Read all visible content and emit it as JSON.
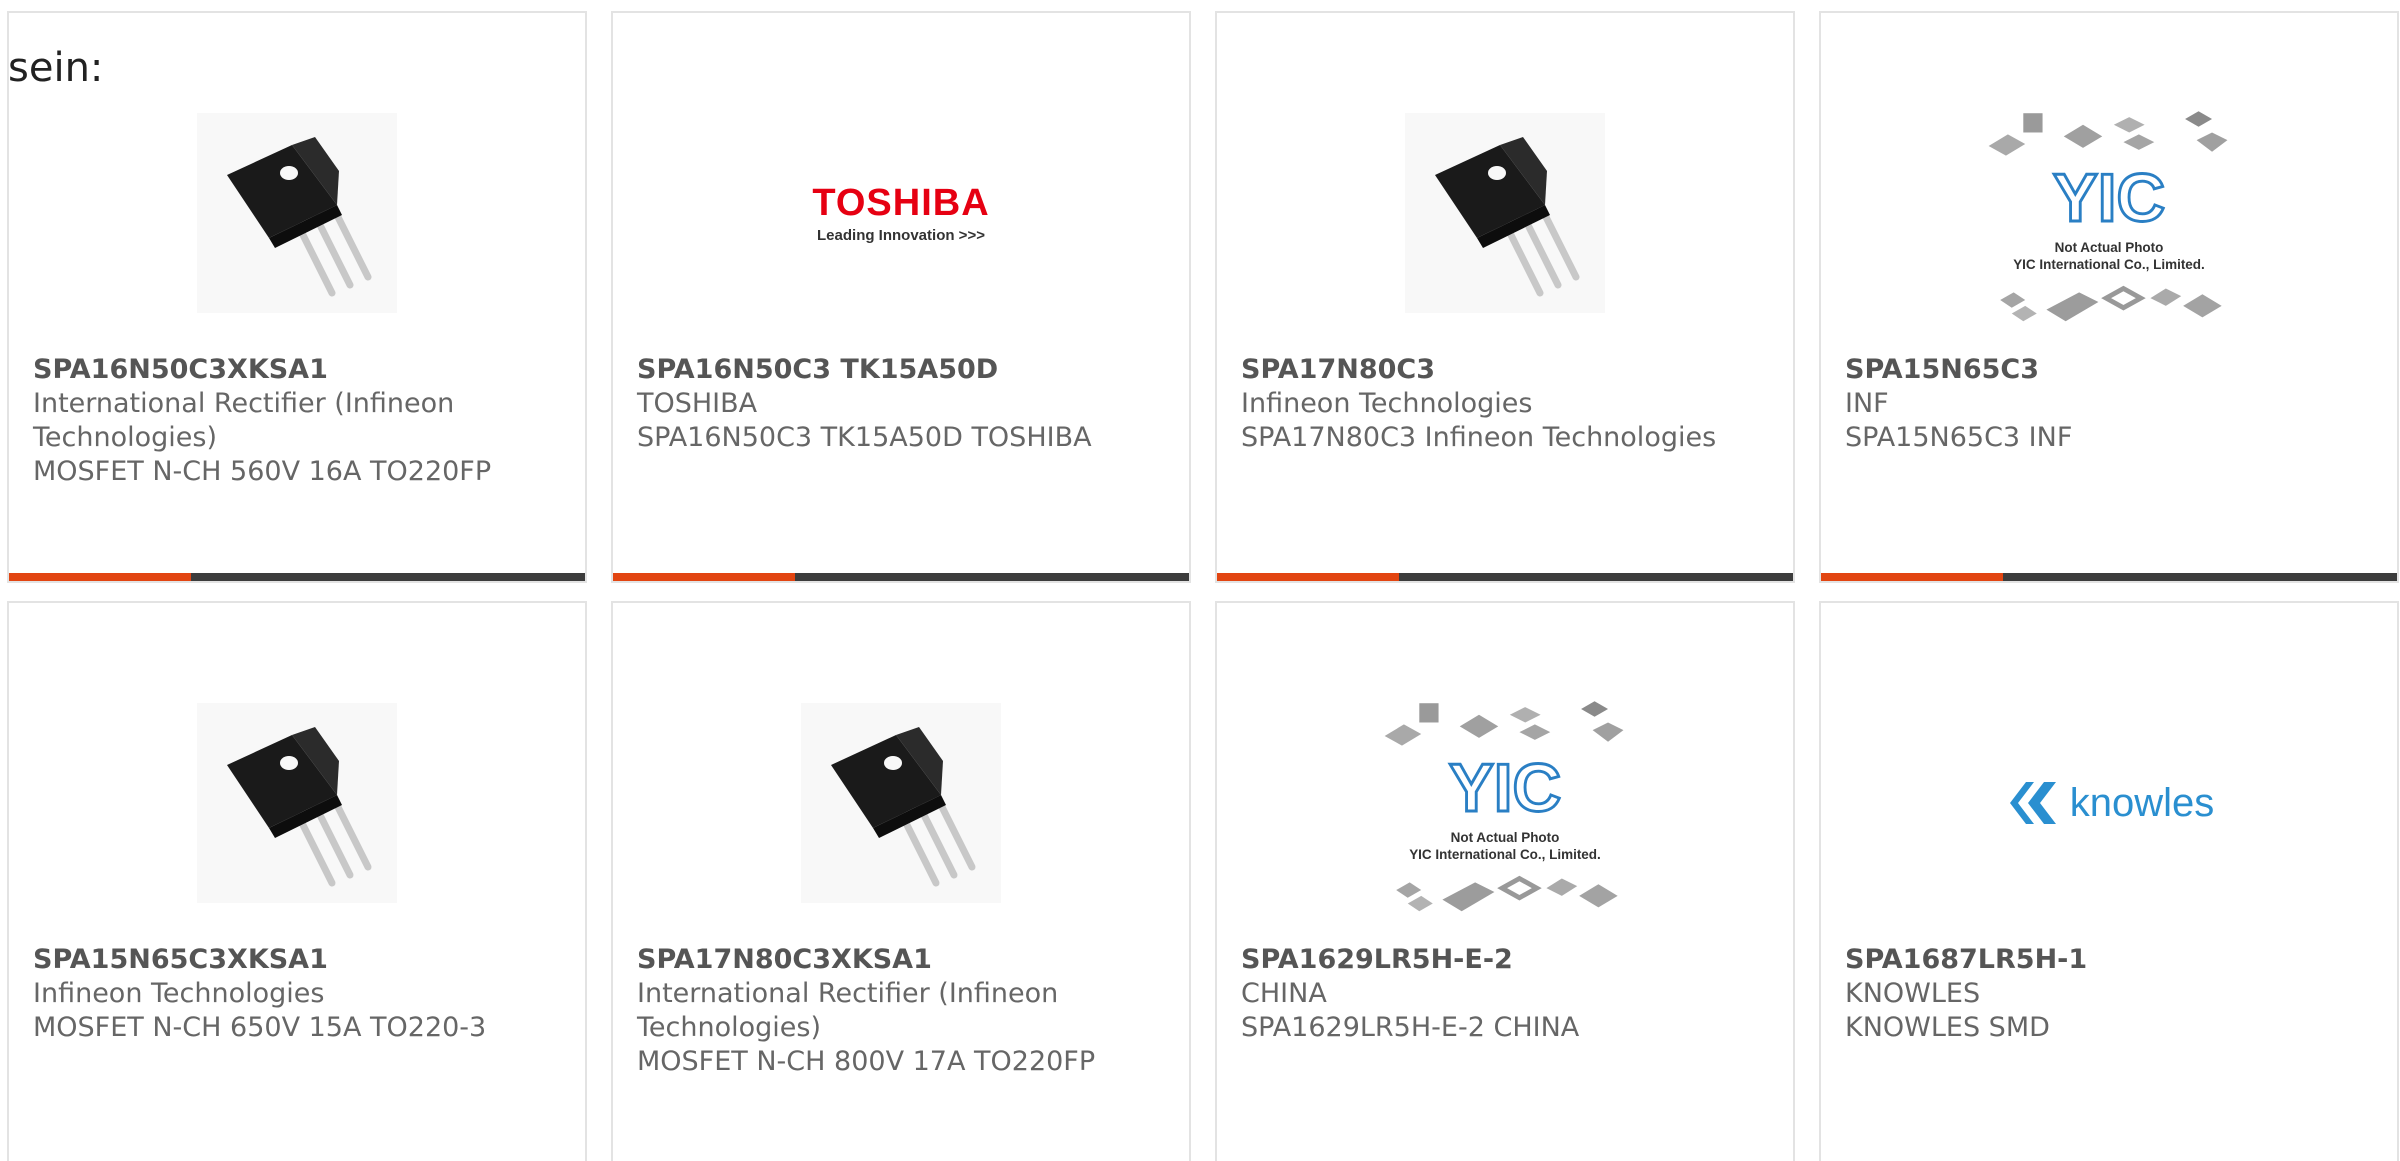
{
  "lead_text": "sein:",
  "products": [
    {
      "part": "SPA16N50C3XKSA1",
      "maker": "International Rectifier (Infineon Technologies)",
      "desc": "MOSFET N-CH 560V 16A TO220FP",
      "image": "to220-transistor-icon"
    },
    {
      "part": "SPA16N50C3 TK15A50D",
      "maker": "TOSHIBA",
      "desc": "SPA16N50C3 TK15A50D TOSHIBA",
      "image": "toshiba-logo",
      "logo_text": "TOSHIBA",
      "logo_tagline": "Leading Innovation >>>",
      "logo_color": "#e60012"
    },
    {
      "part": "SPA17N80C3",
      "maker": "Infineon Technologies",
      "desc": "SPA17N80C3 Infineon Technologies",
      "image": "to220-transistor-icon"
    },
    {
      "part": "SPA15N65C3",
      "maker": "INF",
      "desc": "SPA15N65C3 INF",
      "image": "yic-placeholder",
      "logo_text": "YIC",
      "caption_line1": "Not Actual Photo",
      "caption_line2": "YIC International Co., Limited."
    },
    {
      "part": "SPA15N65C3XKSA1",
      "maker": "Infineon Technologies",
      "desc": "MOSFET N-CH 650V 15A TO220-3",
      "image": "to220-transistor-icon"
    },
    {
      "part": "SPA17N80C3XKSA1",
      "maker": "International Rectifier (Infineon Technologies)",
      "desc": "MOSFET N-CH 800V 17A TO220FP",
      "image": "to220-transistor-icon"
    },
    {
      "part": "SPA1629LR5H-E-2",
      "maker": "CHINA",
      "desc": "SPA1629LR5H-E-2 CHINA",
      "image": "yic-placeholder",
      "logo_text": "YIC",
      "caption_line1": "Not Actual Photo",
      "caption_line2": "YIC International Co., Limited."
    },
    {
      "part": "SPA1687LR5H-1",
      "maker": "KNOWLES",
      "desc": "KNOWLES SMD",
      "image": "knowles-logo",
      "logo_text": "knowles",
      "logo_color": "#2a8fd0"
    }
  ],
  "colors": {
    "accent": "#e24511",
    "bar": "#3c3c3c",
    "card_border": "#e3e3e3"
  }
}
